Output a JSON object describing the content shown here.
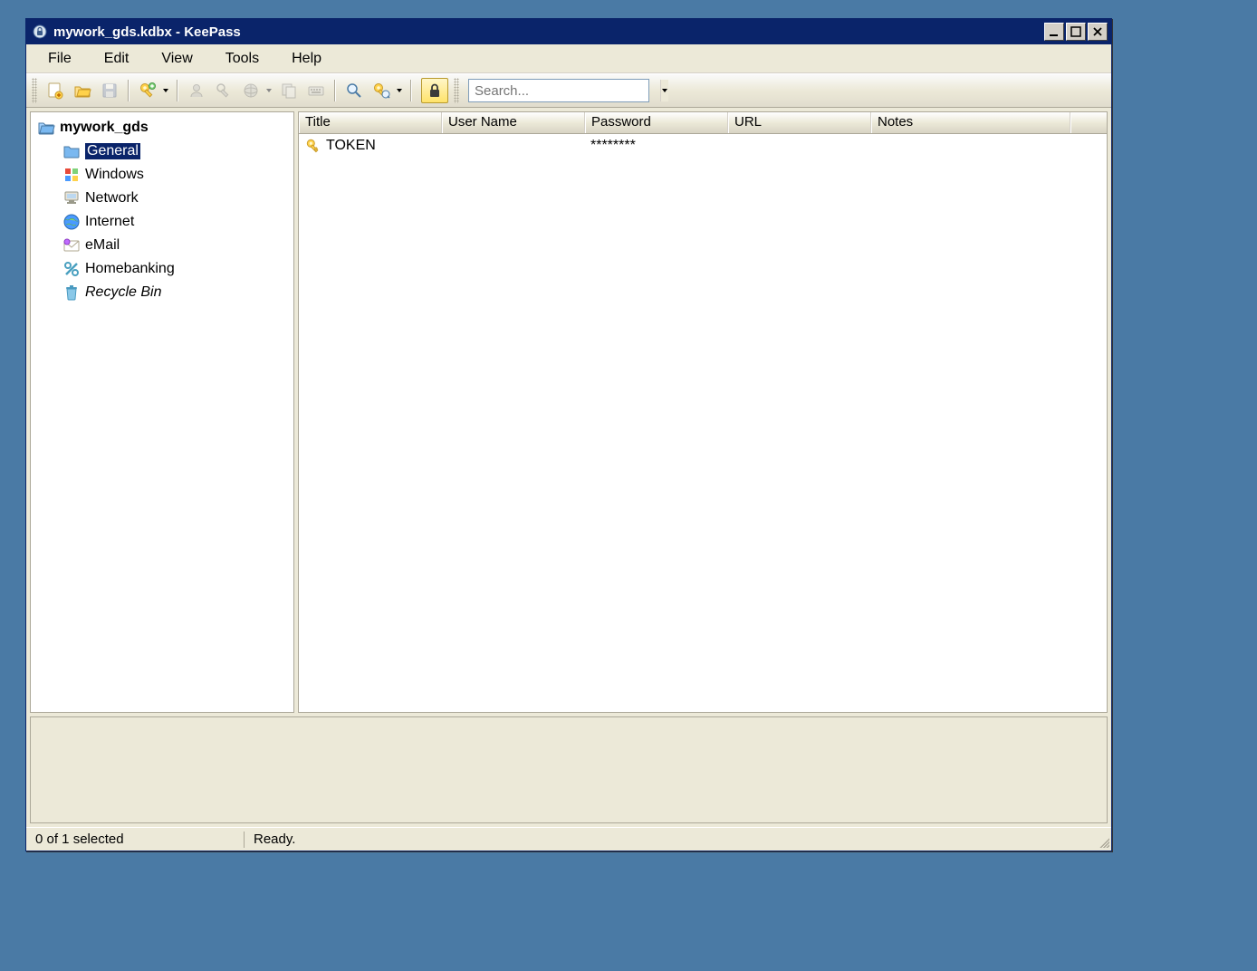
{
  "titlebar": {
    "title": "mywork_gds.kdbx - KeePass"
  },
  "menu": {
    "file": "File",
    "edit": "Edit",
    "view": "View",
    "tools": "Tools",
    "help": "Help"
  },
  "toolbar": {
    "search_placeholder": "Search..."
  },
  "tree": {
    "root": "mywork_gds",
    "items": [
      {
        "label": "General",
        "icon": "folder-blue",
        "selected": true
      },
      {
        "label": "Windows",
        "icon": "windows"
      },
      {
        "label": "Network",
        "icon": "network"
      },
      {
        "label": "Internet",
        "icon": "globe"
      },
      {
        "label": "eMail",
        "icon": "envelope"
      },
      {
        "label": "Homebanking",
        "icon": "percent"
      },
      {
        "label": "Recycle Bin",
        "icon": "trash",
        "italic": true
      }
    ]
  },
  "columns": {
    "title": "Title",
    "username": "User Name",
    "password": "Password",
    "url": "URL",
    "notes": "Notes"
  },
  "entries": [
    {
      "title": "TOKEN",
      "username": "",
      "password": "********",
      "url": "",
      "notes": ""
    }
  ],
  "status": {
    "selection": "0 of 1 selected",
    "ready": "Ready."
  }
}
